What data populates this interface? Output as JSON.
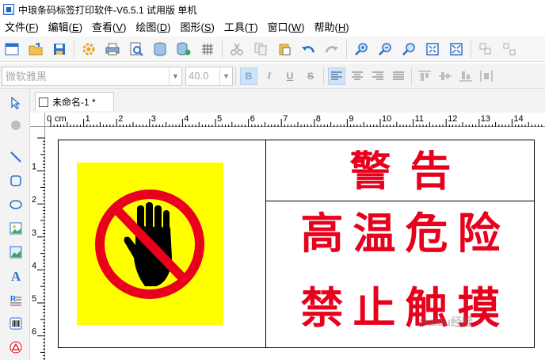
{
  "window": {
    "title": "中琅条码标签打印软件-V6.5.1 试用版 单机"
  },
  "menu": [
    {
      "label": "文件",
      "key": "F"
    },
    {
      "label": "编辑",
      "key": "E"
    },
    {
      "label": "查看",
      "key": "V"
    },
    {
      "label": "绘图",
      "key": "D"
    },
    {
      "label": "图形",
      "key": "S"
    },
    {
      "label": "工具",
      "key": "T"
    },
    {
      "label": "窗口",
      "key": "W"
    },
    {
      "label": "帮助",
      "key": "H"
    }
  ],
  "format_bar": {
    "font_value": "微软雅黑",
    "size_value": "40.0",
    "bold": "B",
    "italic": "I",
    "underline": "U",
    "strike": "S"
  },
  "tab": {
    "name": "未命名-1 *"
  },
  "ruler": {
    "unit": "cm",
    "h_labels": [
      "0",
      "1",
      "2",
      "3",
      "4",
      "5",
      "6",
      "7",
      "8",
      "9",
      "10",
      "11",
      "12",
      "13",
      "14"
    ],
    "v_labels": [
      "1",
      "2",
      "3",
      "4",
      "5",
      "6",
      "7"
    ]
  },
  "label": {
    "title": "警告",
    "line1": "高温危险",
    "line2": "禁止触摸"
  },
  "watermark": "Baidu经验",
  "colors": {
    "warning_red": "#e8001c",
    "sign_yellow": "#ffff00",
    "sign_ring": "#e8001c",
    "hand": "#000000"
  }
}
